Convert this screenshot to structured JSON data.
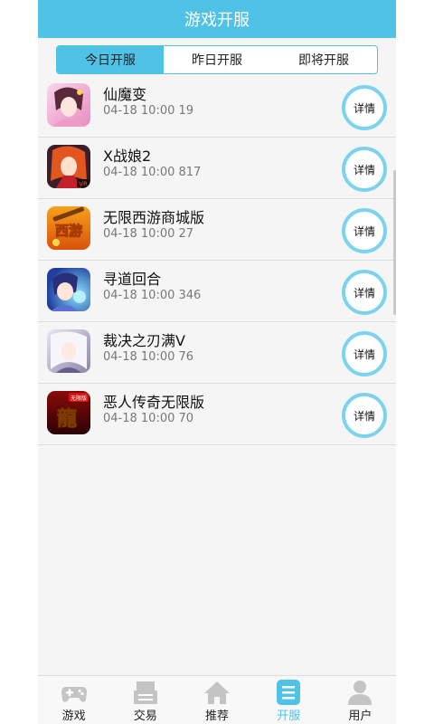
{
  "header": {
    "title": "游戏开服"
  },
  "tabs": [
    {
      "label": "今日开服",
      "active": true
    },
    {
      "label": "昨日开服",
      "active": false
    },
    {
      "label": "即将开服",
      "active": false
    }
  ],
  "games": [
    {
      "name": "仙魔变",
      "time": "04-18 10:00",
      "count": "19",
      "detail": "详情"
    },
    {
      "name": "X战娘2",
      "time": "04-18 10:00",
      "count": "817",
      "detail": "详情"
    },
    {
      "name": "无限西游商城版",
      "time": "04-18 10:00",
      "count": "27",
      "detail": "详情"
    },
    {
      "name": "寻道回合",
      "time": "04-18 10:00",
      "count": "346",
      "detail": "详情"
    },
    {
      "name": "裁决之刃满V",
      "time": "04-18 10:00",
      "count": "76",
      "detail": "详情"
    },
    {
      "name": "恶人传奇无限版",
      "time": "04-18 10:00",
      "count": "70",
      "detail": "详情"
    }
  ],
  "icon_labels": {
    "vr_badge": "VR",
    "xiyou_logo": "西游",
    "dragon_banner": "无限版",
    "dragon_glyph": "龍"
  },
  "nav": [
    {
      "label": "游戏",
      "icon": "gamepad-icon",
      "active": false
    },
    {
      "label": "交易",
      "icon": "trade-icon",
      "active": false
    },
    {
      "label": "推荐",
      "icon": "home-icon",
      "active": false
    },
    {
      "label": "开服",
      "icon": "list-icon",
      "active": true
    },
    {
      "label": "用户",
      "icon": "user-icon",
      "active": false
    }
  ],
  "colors": {
    "accent": "#4fc2e6",
    "ring": "#7dd3ee",
    "background": "#f5f5f5"
  }
}
